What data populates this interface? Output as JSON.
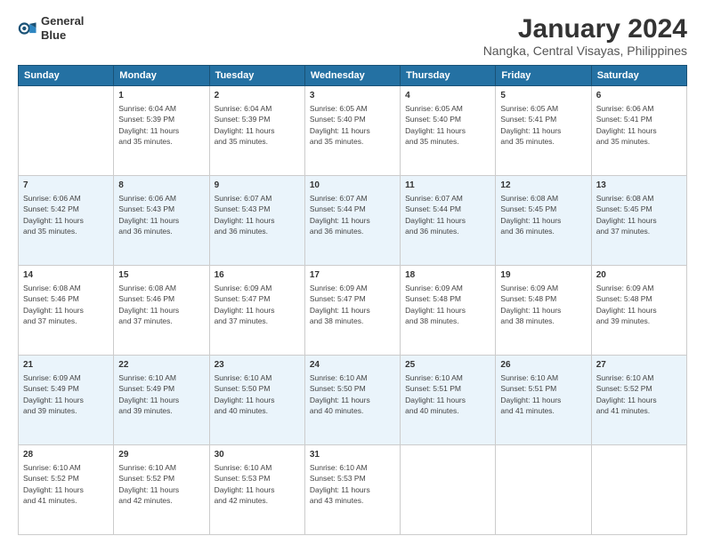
{
  "header": {
    "logo_line1": "General",
    "logo_line2": "Blue",
    "title": "January 2024",
    "subtitle": "Nangka, Central Visayas, Philippines"
  },
  "days_of_week": [
    "Sunday",
    "Monday",
    "Tuesday",
    "Wednesday",
    "Thursday",
    "Friday",
    "Saturday"
  ],
  "weeks": [
    [
      {
        "num": "",
        "info": ""
      },
      {
        "num": "1",
        "info": "Sunrise: 6:04 AM\nSunset: 5:39 PM\nDaylight: 11 hours\nand 35 minutes."
      },
      {
        "num": "2",
        "info": "Sunrise: 6:04 AM\nSunset: 5:39 PM\nDaylight: 11 hours\nand 35 minutes."
      },
      {
        "num": "3",
        "info": "Sunrise: 6:05 AM\nSunset: 5:40 PM\nDaylight: 11 hours\nand 35 minutes."
      },
      {
        "num": "4",
        "info": "Sunrise: 6:05 AM\nSunset: 5:40 PM\nDaylight: 11 hours\nand 35 minutes."
      },
      {
        "num": "5",
        "info": "Sunrise: 6:05 AM\nSunset: 5:41 PM\nDaylight: 11 hours\nand 35 minutes."
      },
      {
        "num": "6",
        "info": "Sunrise: 6:06 AM\nSunset: 5:41 PM\nDaylight: 11 hours\nand 35 minutes."
      }
    ],
    [
      {
        "num": "7",
        "info": "Sunrise: 6:06 AM\nSunset: 5:42 PM\nDaylight: 11 hours\nand 35 minutes."
      },
      {
        "num": "8",
        "info": "Sunrise: 6:06 AM\nSunset: 5:43 PM\nDaylight: 11 hours\nand 36 minutes."
      },
      {
        "num": "9",
        "info": "Sunrise: 6:07 AM\nSunset: 5:43 PM\nDaylight: 11 hours\nand 36 minutes."
      },
      {
        "num": "10",
        "info": "Sunrise: 6:07 AM\nSunset: 5:44 PM\nDaylight: 11 hours\nand 36 minutes."
      },
      {
        "num": "11",
        "info": "Sunrise: 6:07 AM\nSunset: 5:44 PM\nDaylight: 11 hours\nand 36 minutes."
      },
      {
        "num": "12",
        "info": "Sunrise: 6:08 AM\nSunset: 5:45 PM\nDaylight: 11 hours\nand 36 minutes."
      },
      {
        "num": "13",
        "info": "Sunrise: 6:08 AM\nSunset: 5:45 PM\nDaylight: 11 hours\nand 37 minutes."
      }
    ],
    [
      {
        "num": "14",
        "info": "Sunrise: 6:08 AM\nSunset: 5:46 PM\nDaylight: 11 hours\nand 37 minutes."
      },
      {
        "num": "15",
        "info": "Sunrise: 6:08 AM\nSunset: 5:46 PM\nDaylight: 11 hours\nand 37 minutes."
      },
      {
        "num": "16",
        "info": "Sunrise: 6:09 AM\nSunset: 5:47 PM\nDaylight: 11 hours\nand 37 minutes."
      },
      {
        "num": "17",
        "info": "Sunrise: 6:09 AM\nSunset: 5:47 PM\nDaylight: 11 hours\nand 38 minutes."
      },
      {
        "num": "18",
        "info": "Sunrise: 6:09 AM\nSunset: 5:48 PM\nDaylight: 11 hours\nand 38 minutes."
      },
      {
        "num": "19",
        "info": "Sunrise: 6:09 AM\nSunset: 5:48 PM\nDaylight: 11 hours\nand 38 minutes."
      },
      {
        "num": "20",
        "info": "Sunrise: 6:09 AM\nSunset: 5:48 PM\nDaylight: 11 hours\nand 39 minutes."
      }
    ],
    [
      {
        "num": "21",
        "info": "Sunrise: 6:09 AM\nSunset: 5:49 PM\nDaylight: 11 hours\nand 39 minutes."
      },
      {
        "num": "22",
        "info": "Sunrise: 6:10 AM\nSunset: 5:49 PM\nDaylight: 11 hours\nand 39 minutes."
      },
      {
        "num": "23",
        "info": "Sunrise: 6:10 AM\nSunset: 5:50 PM\nDaylight: 11 hours\nand 40 minutes."
      },
      {
        "num": "24",
        "info": "Sunrise: 6:10 AM\nSunset: 5:50 PM\nDaylight: 11 hours\nand 40 minutes."
      },
      {
        "num": "25",
        "info": "Sunrise: 6:10 AM\nSunset: 5:51 PM\nDaylight: 11 hours\nand 40 minutes."
      },
      {
        "num": "26",
        "info": "Sunrise: 6:10 AM\nSunset: 5:51 PM\nDaylight: 11 hours\nand 41 minutes."
      },
      {
        "num": "27",
        "info": "Sunrise: 6:10 AM\nSunset: 5:52 PM\nDaylight: 11 hours\nand 41 minutes."
      }
    ],
    [
      {
        "num": "28",
        "info": "Sunrise: 6:10 AM\nSunset: 5:52 PM\nDaylight: 11 hours\nand 41 minutes."
      },
      {
        "num": "29",
        "info": "Sunrise: 6:10 AM\nSunset: 5:52 PM\nDaylight: 11 hours\nand 42 minutes."
      },
      {
        "num": "30",
        "info": "Sunrise: 6:10 AM\nSunset: 5:53 PM\nDaylight: 11 hours\nand 42 minutes."
      },
      {
        "num": "31",
        "info": "Sunrise: 6:10 AM\nSunset: 5:53 PM\nDaylight: 11 hours\nand 43 minutes."
      },
      {
        "num": "",
        "info": ""
      },
      {
        "num": "",
        "info": ""
      },
      {
        "num": "",
        "info": ""
      }
    ]
  ]
}
